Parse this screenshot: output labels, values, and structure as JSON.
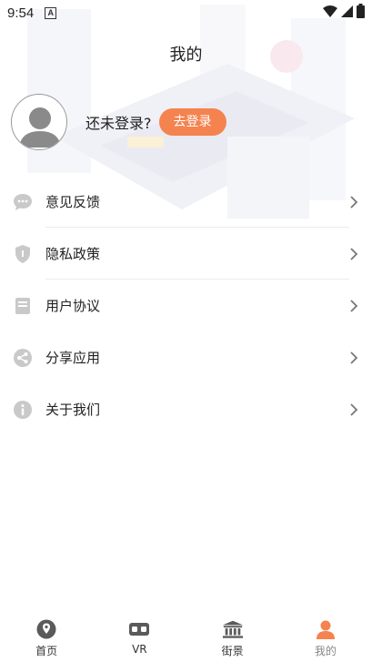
{
  "status_bar": {
    "time": "9:54",
    "notification_badge": "A",
    "icons": [
      "wifi-icon",
      "signal-icon",
      "battery-icon"
    ]
  },
  "header": {
    "title": "我的"
  },
  "profile": {
    "login_hint": "还未登录?",
    "login_button": "去登录"
  },
  "menu": {
    "items": [
      {
        "label": "意见反馈",
        "icon": "chat-icon"
      },
      {
        "label": "隐私政策",
        "icon": "shield-icon"
      },
      {
        "label": "用户协议",
        "icon": "document-icon"
      },
      {
        "label": "分享应用",
        "icon": "share-icon"
      },
      {
        "label": "关于我们",
        "icon": "info-icon"
      }
    ]
  },
  "tabbar": {
    "tabs": [
      {
        "label": "首页",
        "icon": "location-pin-icon"
      },
      {
        "label": "VR",
        "icon": "vr-headset-icon"
      },
      {
        "label": "街景",
        "icon": "building-icon"
      },
      {
        "label": "我的",
        "icon": "person-icon"
      }
    ],
    "active_index": 3
  },
  "colors": {
    "accent": "#f5834f",
    "icon_gray": "#c9c9c9",
    "tab_icon": "#5a5a5a"
  }
}
